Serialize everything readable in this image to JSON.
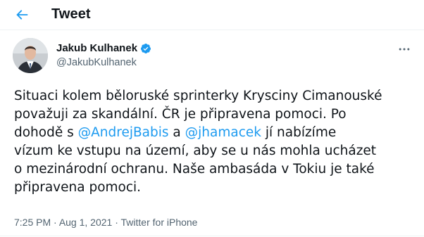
{
  "header": {
    "title": "Tweet",
    "back_icon": "arrow-left-icon"
  },
  "author": {
    "name": "Jakub Kulhanek",
    "handle": "@JakubKulhanek",
    "verified": true,
    "verified_color": "#1d9bf0"
  },
  "tweet": {
    "lines": [
      [
        {
          "t": "Situaci kolem běloruské sprinterky Krysciny Cimanouské"
        }
      ],
      [
        {
          "t": "považuji za skandální. ČR je připravena pomoci. Po"
        }
      ],
      [
        {
          "t": "dohodě s "
        },
        {
          "t": "@AndrejBabis",
          "m": true
        },
        {
          "t": " a "
        },
        {
          "t": "@jhamacek",
          "m": true
        },
        {
          "t": " jí nabízíme"
        }
      ],
      [
        {
          "t": "vízum ke vstupu na území, aby se u nás mohla ucházet"
        }
      ],
      [
        {
          "t": "o mezinárodní ochranu. Naše ambasáda v Tokiu je také"
        }
      ],
      [
        {
          "t": "připravena pomoci."
        }
      ]
    ],
    "mention_color": "#1d9bf0"
  },
  "meta": {
    "time": "7:25 PM",
    "separator": "·",
    "date": "Aug 1, 2021",
    "source": "Twitter for iPhone"
  }
}
